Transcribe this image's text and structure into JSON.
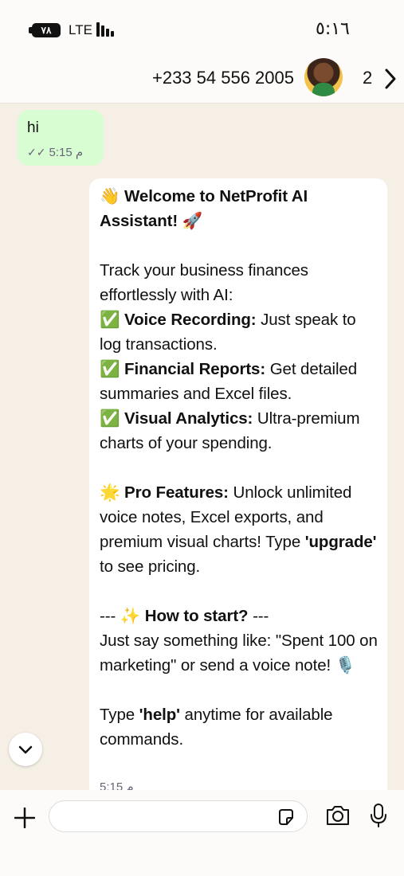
{
  "status_bar": {
    "battery": "٧٨",
    "network": "LTE",
    "time": "٥:١٦"
  },
  "header": {
    "contact": "+233 54 556 2005",
    "back_count": "2"
  },
  "messages": {
    "outgoing": {
      "text": "hi",
      "time": "م 5:15",
      "status_icon": "double-check-icon"
    },
    "incoming": {
      "title": "👋 Welcome to NetProfit AI Assistant! 🚀",
      "intro": "Track your business finances effortlessly with AI:",
      "features": [
        {
          "icon": "✅",
          "label": "Voice Recording:",
          "text": " Just speak to log transactions."
        },
        {
          "icon": "✅",
          "label": "Financial Reports:",
          "text": " Get detailed summaries and Excel files."
        },
        {
          "icon": "✅",
          "label": "Visual Analytics:",
          "text": " Ultra-premium charts of your spending."
        }
      ],
      "pro_icon": "🌟",
      "pro_label": "Pro Features:",
      "pro_text_1": " Unlock unlimited voice notes, Excel exports, and premium visual charts! Type ",
      "pro_keyword": "'upgrade'",
      "pro_text_2": " to see pricing.",
      "start_prefix": "--- ✨ ",
      "start_label": "How to start?",
      "start_suffix": " ---",
      "start_text": "Just say something like: \"Spent 100 on marketing\" or send a voice note! 🎙️",
      "help_text_1": "Type ",
      "help_keyword": "'help'",
      "help_text_2": " anytime for available commands.",
      "time": "م 5:15"
    }
  },
  "composer": {
    "placeholder": ""
  }
}
